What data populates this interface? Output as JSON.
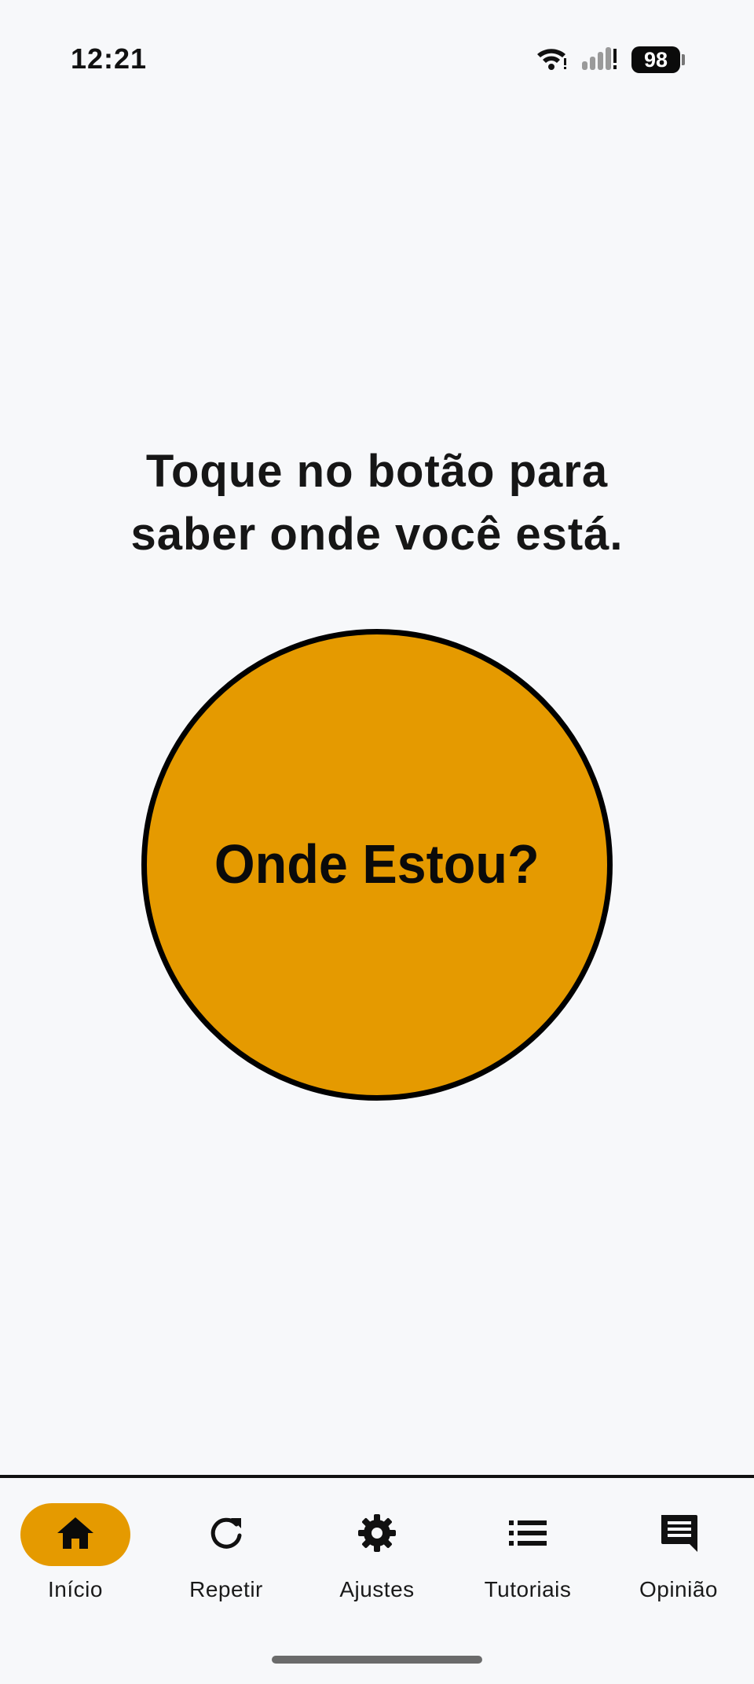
{
  "status_bar": {
    "time": "12:21",
    "battery": "98",
    "icons": [
      "wifi-icon",
      "signal-icon",
      "battery-icon"
    ]
  },
  "main": {
    "prompt": "Toque no botão para saber onde você está.",
    "button_label": "Onde Estou?"
  },
  "nav": {
    "items": [
      {
        "label": "Início",
        "icon": "home-icon",
        "active": true
      },
      {
        "label": "Repetir",
        "icon": "refresh-icon",
        "active": false
      },
      {
        "label": "Ajustes",
        "icon": "gear-icon",
        "active": false
      },
      {
        "label": "Tutoriais",
        "icon": "list-icon",
        "active": false
      },
      {
        "label": "Opinião",
        "icon": "feedback-icon",
        "active": false
      }
    ]
  },
  "colors": {
    "accent": "#e59a00",
    "background": "#f7f8fa",
    "text": "#111111"
  }
}
